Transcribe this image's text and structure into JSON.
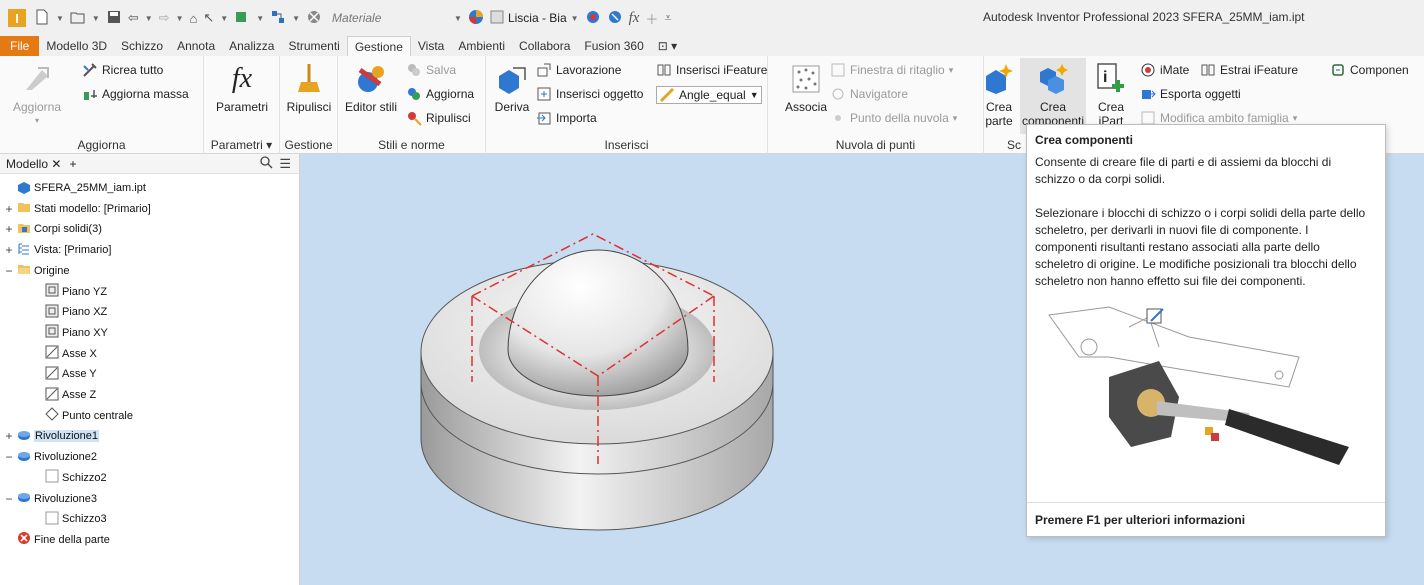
{
  "titlebar": {
    "material_placeholder": "Materiale",
    "appearance_value": "Liscia - Bia",
    "app_title": "Autodesk Inventor Professional 2023   SFERA_25MM_iam.ipt"
  },
  "tabs": [
    "File",
    "Modello 3D",
    "Schizzo",
    "Annota",
    "Analizza",
    "Strumenti",
    "Gestione",
    "Vista",
    "Ambienti",
    "Collabora",
    "Fusion 360"
  ],
  "active_tab": "Gestione",
  "ribbon": {
    "aggiorna": {
      "title": "Aggiorna",
      "big_label": "Aggiorna",
      "ricrea": "Ricrea tutto",
      "aggiorna_massa": "Aggiorna massa"
    },
    "parametri": {
      "title": "Parametri",
      "big_label": "Parametri"
    },
    "gestione": {
      "title": "Gestione",
      "big_label": "Ripulisci"
    },
    "stili": {
      "title": "Stili e norme",
      "big_label": "Editor stili",
      "salva": "Salva",
      "aggiorna": "Aggiorna",
      "ripulisci": "Ripulisci"
    },
    "inserisci": {
      "title": "Inserisci",
      "deriva": "Deriva",
      "lavorazione": "Lavorazione",
      "inserisci_oggetto": "Inserisci oggetto",
      "importa": "Importa",
      "inserisci_ifeature": "Inserisci iFeature",
      "angle_equal": "Angle_equal"
    },
    "nuvola": {
      "title": "Nuvola di punti",
      "associa": "Associa",
      "finestra": "Finestra di ritaglio",
      "navigatore": "Navigatore",
      "punto_nuvola": "Punto della nuvola"
    },
    "scheletro": {
      "title": "Sc",
      "crea_parte_1": "Crea",
      "crea_parte_2": "parte",
      "crea_comp_1": "Crea",
      "crea_comp_2": "componenti",
      "crea_ipart_1": "Crea",
      "crea_ipart_2": "iPart",
      "imate": "iMate",
      "estrai_ifeature": "Estrai iFeature",
      "esporta_oggetti": "Esporta oggetti",
      "modifica_ambito": "Modifica ambito famiglia",
      "componente": "Componen"
    }
  },
  "browser": {
    "tab_label": "Modello",
    "items": [
      {
        "label": "SFERA_25MM_iam.ipt",
        "expander": "",
        "icon": "part-icon"
      },
      {
        "label": "Stati modello: [Primario]",
        "expander": "+",
        "icon": "folder-icon"
      },
      {
        "label": "Corpi solidi(3)",
        "expander": "+",
        "icon": "solid-bodies-icon"
      },
      {
        "label": "Vista: [Primario]",
        "expander": "+",
        "icon": "view-icon"
      },
      {
        "label": "Origine",
        "expander": "−",
        "icon": "folder-open-icon"
      },
      {
        "label": "Piano YZ",
        "expander": "",
        "icon": "plane-icon"
      },
      {
        "label": "Piano XZ",
        "expander": "",
        "icon": "plane-icon"
      },
      {
        "label": "Piano XY",
        "expander": "",
        "icon": "plane-icon"
      },
      {
        "label": "Asse X",
        "expander": "",
        "icon": "axis-icon"
      },
      {
        "label": "Asse Y",
        "expander": "",
        "icon": "axis-icon"
      },
      {
        "label": "Asse Z",
        "expander": "",
        "icon": "axis-icon"
      },
      {
        "label": "Punto centrale",
        "expander": "",
        "icon": "point-icon"
      },
      {
        "label": "Rivoluzione1",
        "expander": "+",
        "icon": "revolve-icon",
        "selected": true
      },
      {
        "label": "Rivoluzione2",
        "expander": "−",
        "icon": "revolve-icon"
      },
      {
        "label": "Schizzo2",
        "expander": "",
        "icon": "sketch-icon"
      },
      {
        "label": "Rivoluzione3",
        "expander": "−",
        "icon": "revolve-icon"
      },
      {
        "label": "Schizzo3",
        "expander": "",
        "icon": "sketch-icon"
      },
      {
        "label": "Fine della parte",
        "expander": "",
        "icon": "end-of-part-icon"
      }
    ]
  },
  "tooltip": {
    "title": "Crea componenti",
    "p1": "Consente di creare file di parti e di assiemi da blocchi di schizzo o da corpi solidi.",
    "p2": "Selezionare i blocchi di schizzo o i corpi solidi della parte dello scheletro, per derivarli in nuovi file di componente. I componenti risultanti restano associati alla parte dello scheletro di origine. Le modifiche posizionali tra blocchi dello scheletro non hanno effetto sui file dei componenti.",
    "footer": "Premere F1 per ulteriori informazioni"
  },
  "colors": {
    "file_tab": "#e67a12",
    "viewport": "#c7dcf0",
    "selection": "#cfe3f7",
    "sketch_lines": "#e03030"
  }
}
